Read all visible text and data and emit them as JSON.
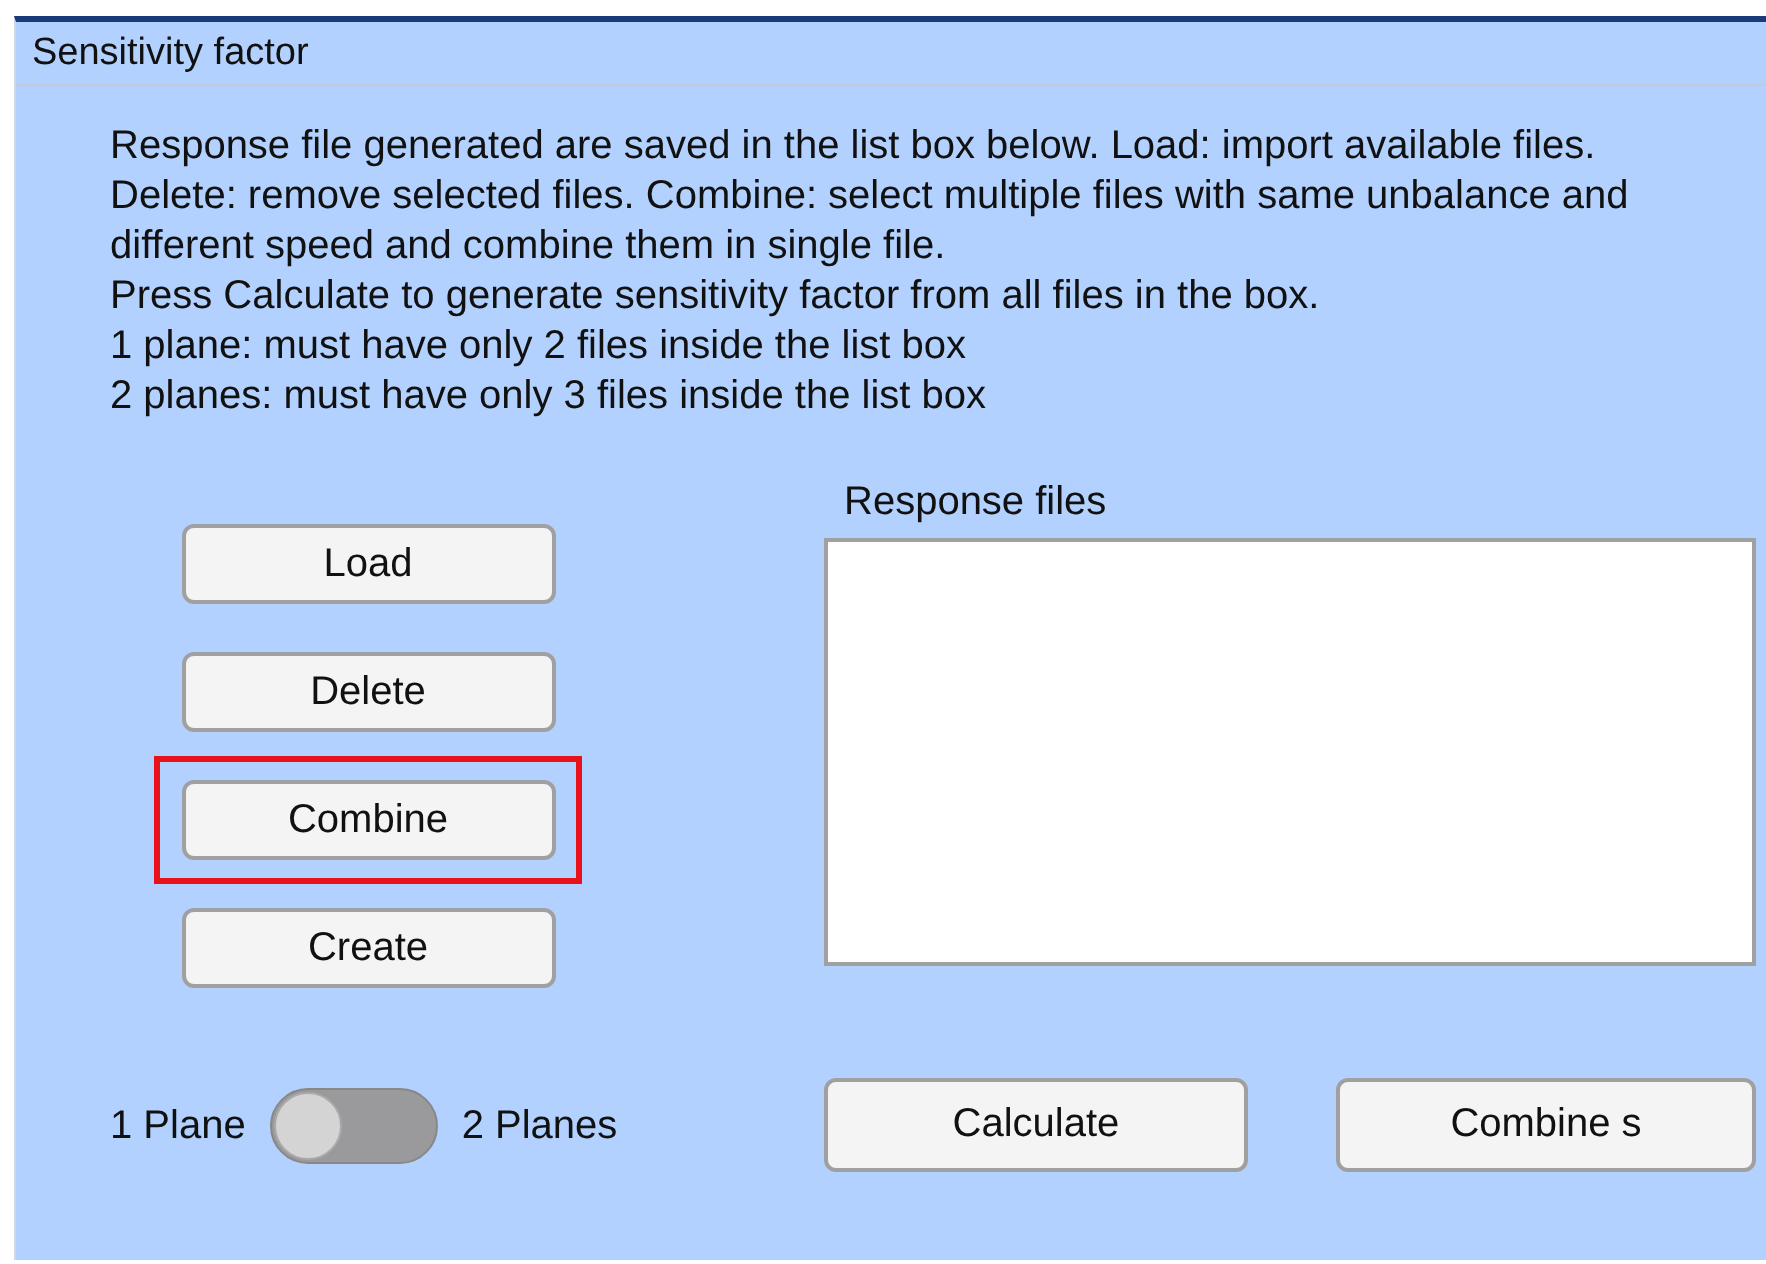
{
  "panel": {
    "title": "Sensitivity factor"
  },
  "instructions": [
    "Response file generated are saved in the list box below. Load: import available files. Delete: remove selected files. Combine: select multiple files with same unbalance and different speed and combine them in single file.",
    "Press Calculate to generate sensitivity factor from all files in the box.",
    "1 plane: must have only 2 files inside the list box",
    "2 planes: must have only 3 files inside the list box"
  ],
  "buttons": [
    {
      "label": "Load",
      "highlighted": false
    },
    {
      "label": "Delete",
      "highlighted": false
    },
    {
      "label": "Combine",
      "highlighted": true
    },
    {
      "label": "Create",
      "highlighted": false
    }
  ],
  "plane_switch": {
    "off_label": "1 Plane",
    "on_label": "2 Planes",
    "on": false
  },
  "list_box": {
    "label": "Response files"
  },
  "bottom_buttons": [
    "Calculate",
    "Combine s"
  ]
}
